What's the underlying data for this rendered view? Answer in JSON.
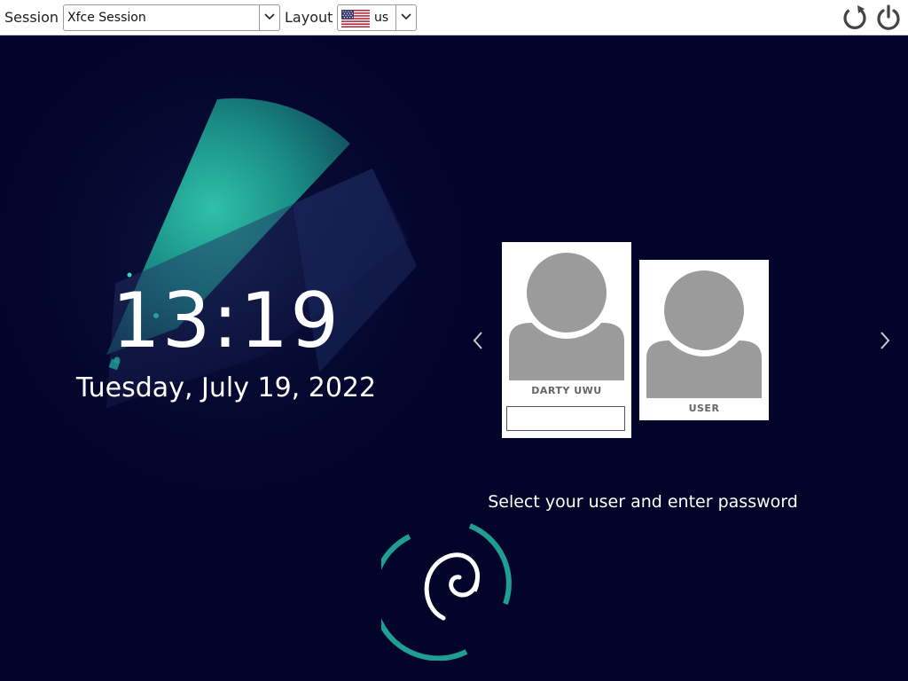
{
  "topbar": {
    "session_label": "Session",
    "session_value": "Xfce Session",
    "layout_label": "Layout",
    "layout_value": "us",
    "layout_flag_icon": "us-flag-icon",
    "restart_icon": "restart-icon",
    "power_icon": "power-icon"
  },
  "clock": {
    "time": "13:19",
    "date": "Tuesday, July 19, 2022"
  },
  "users": [
    {
      "name": "DARTY UWU",
      "selected": true,
      "password_value": ""
    },
    {
      "name": "USER",
      "selected": false
    }
  ],
  "prompt": "Select your user and enter password",
  "colors": {
    "background": "#03042a",
    "accent_teal": "#1f9e93",
    "avatar_gray": "#9b9b9b",
    "topbar": "#ffffff"
  }
}
